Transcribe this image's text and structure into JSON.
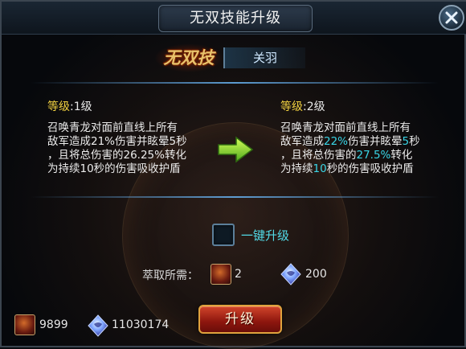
{
  "window": {
    "title": "无双技能升级"
  },
  "skill": {
    "badge": "无双技",
    "hero_name": "关羽"
  },
  "current": {
    "level_label": "等级",
    "level_value": ":1级",
    "desc_lines": [
      "召唤青龙对面前直线上所有",
      "敌军造成21%伤害并眩晕5秒",
      "，且将总伤害的26.25%转化",
      "为持续10秒的伤害吸收护盾"
    ]
  },
  "next": {
    "level_label": "等级",
    "level_value": ":2级",
    "line1": "召唤青龙对面前直线上所有",
    "line2_a": "敌军造成",
    "line2_hl1": "22%",
    "line2_b": "伤害并眩晕",
    "line2_hl2": "5",
    "line2_c": "秒",
    "line3_a": "，且将总伤害的",
    "line3_hl": "27.5%",
    "line3_b": "转化",
    "line4_a": "为持续",
    "line4_hl": "10",
    "line4_b": "秒的伤害吸收护盾"
  },
  "one_key": {
    "label": "一键升级",
    "checked": false
  },
  "cost": {
    "label": "萃取所需：",
    "item_count": "2",
    "soul_count": "200"
  },
  "inventory": {
    "item_count": "9899",
    "soul_count": "11030174"
  },
  "upgrade_button": {
    "label": "升级"
  },
  "colors": {
    "highlight": "#39d5e6",
    "level_label": "#f0d040",
    "button": "#b2261a"
  },
  "icons": {
    "close": "close-icon",
    "arrow": "arrow-right-icon",
    "item": "hero-fragment-icon",
    "soul": "soul-gem-icon"
  }
}
